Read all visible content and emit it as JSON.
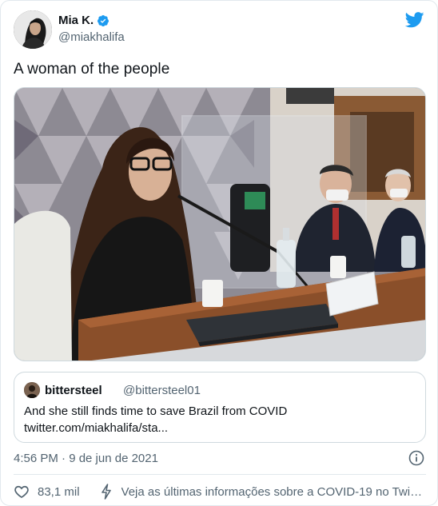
{
  "tweet": {
    "author_name": "Mia K.",
    "author_handle": "@miakhalifa",
    "text": "A woman of the people",
    "timestamp": "4:56 PM · 9 de jun de 2021",
    "likes": "83,1 mil",
    "covid_info": "Veja as últimas informações sobre a COVID-19 no Twitt..."
  },
  "quote": {
    "author_name": "bittersteel",
    "author_handle": "@bittersteel01",
    "text": "And she still finds time to save Brazil from COVID twitter.com/miakhalifa/sta..."
  },
  "colors": {
    "twitter_blue": "#1d9bf0",
    "secondary_text": "#536471",
    "border": "#cfd9de"
  },
  "icons": [
    "verified-icon",
    "twitter-bird-icon",
    "info-icon",
    "heart-icon",
    "bolt-icon"
  ]
}
